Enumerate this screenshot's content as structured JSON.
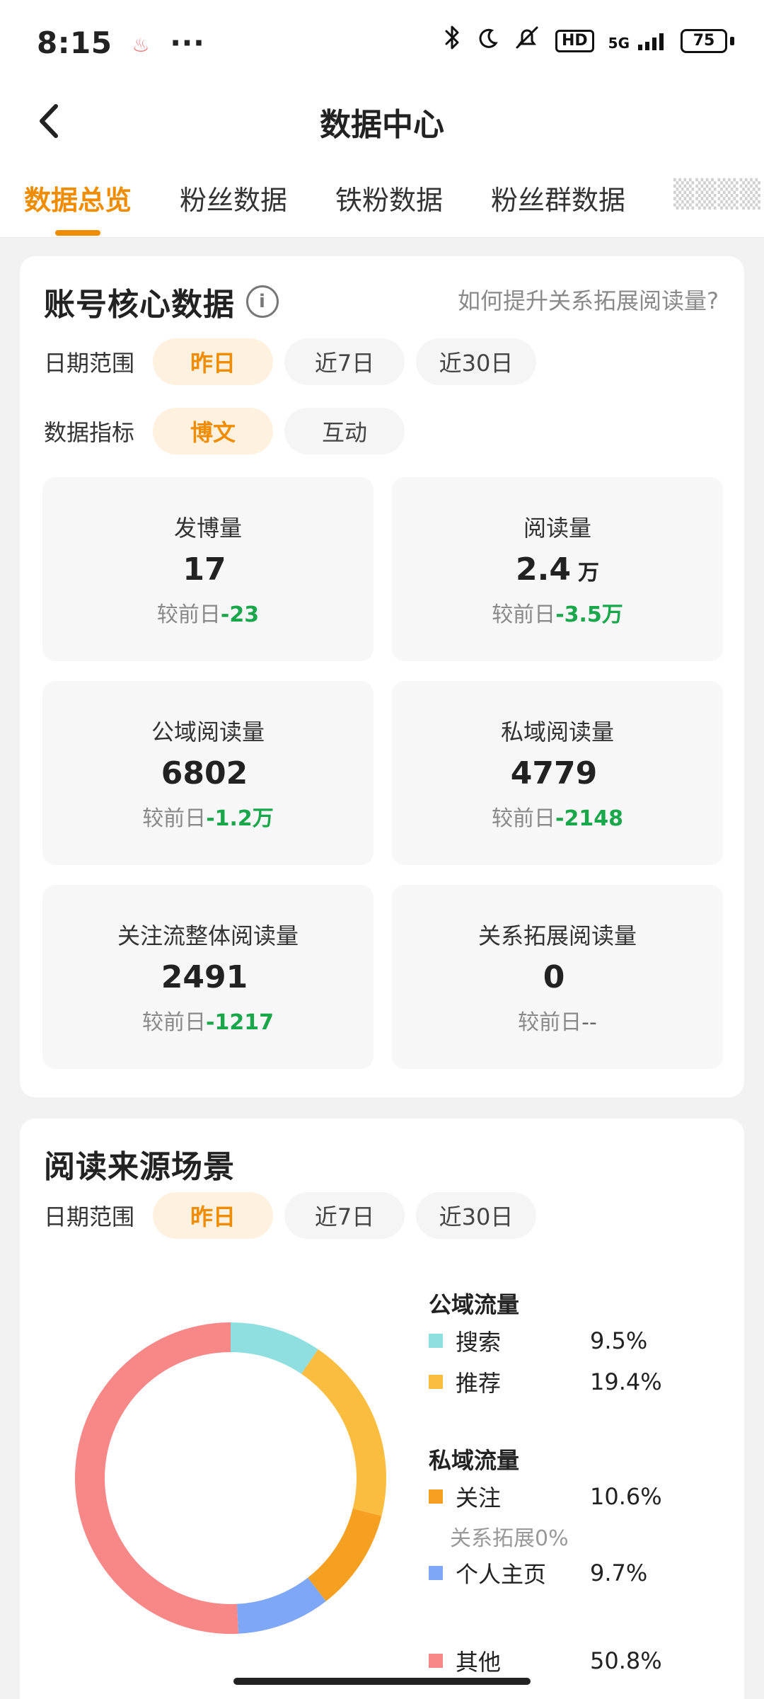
{
  "status": {
    "time": "8:15",
    "more": "···",
    "network": "5G",
    "battery": "75",
    "hd": "HD"
  },
  "header": {
    "title": "数据中心"
  },
  "tabs": [
    {
      "label": "数据总览",
      "active": true
    },
    {
      "label": "粉丝数据"
    },
    {
      "label": "铁粉数据"
    },
    {
      "label": "粉丝群数据"
    },
    {
      "label": "▒▒▒▒"
    }
  ],
  "core": {
    "title": "账号核心数据",
    "help": "如何提升关系拓展阅读量?",
    "date_label": "日期范围",
    "date_options": [
      "昨日",
      "近7日",
      "近30日"
    ],
    "metric_label": "数据指标",
    "metric_options": [
      "博文",
      "互动"
    ],
    "delta_prefix": "较前日",
    "tiles": [
      {
        "label": "发博量",
        "value": "17",
        "unit": "",
        "delta": "-23"
      },
      {
        "label": "阅读量",
        "value": "2.4",
        "unit": "万",
        "delta": "-3.5万"
      },
      {
        "label": "公域阅读量",
        "value": "6802",
        "unit": "",
        "delta": "-1.2万"
      },
      {
        "label": "私域阅读量",
        "value": "4779",
        "unit": "",
        "delta": "-2148"
      },
      {
        "label": "关注流整体阅读量",
        "value": "2491",
        "unit": "",
        "delta": "-1217"
      },
      {
        "label": "关系拓展阅读量",
        "value": "0",
        "unit": "",
        "delta": "--"
      }
    ]
  },
  "source": {
    "title": "阅读来源场景",
    "date_label": "日期范围",
    "date_options": [
      "昨日",
      "近7日",
      "近30日"
    ],
    "public_group": "公域流量",
    "private_group": "私域流量",
    "legend": [
      {
        "name": "搜索",
        "value_text": "9.5%",
        "color": "#8fdfe0"
      },
      {
        "name": "推荐",
        "value_text": "19.4%",
        "color": "#fbbd3f"
      },
      {
        "name": "关注",
        "value_text": "10.6%",
        "color": "#f6a021"
      },
      {
        "name": "个人主页",
        "value_text": "9.7%",
        "color": "#7fa7f7"
      },
      {
        "name": "其他",
        "value_text": "50.8%",
        "color": "#f88787"
      }
    ],
    "sub_note": "关系拓展0%"
  },
  "chart_data": {
    "type": "pie",
    "categories": [
      "搜索",
      "推荐",
      "关注",
      "个人主页",
      "其他"
    ],
    "values": [
      9.5,
      19.4,
      10.6,
      9.7,
      50.8
    ],
    "colors": [
      "#8fdfe0",
      "#fbbd3f",
      "#f6a021",
      "#7fa7f7",
      "#f88787"
    ]
  },
  "colors": {
    "accent": "#f08c00",
    "green": "#1aa64a"
  }
}
